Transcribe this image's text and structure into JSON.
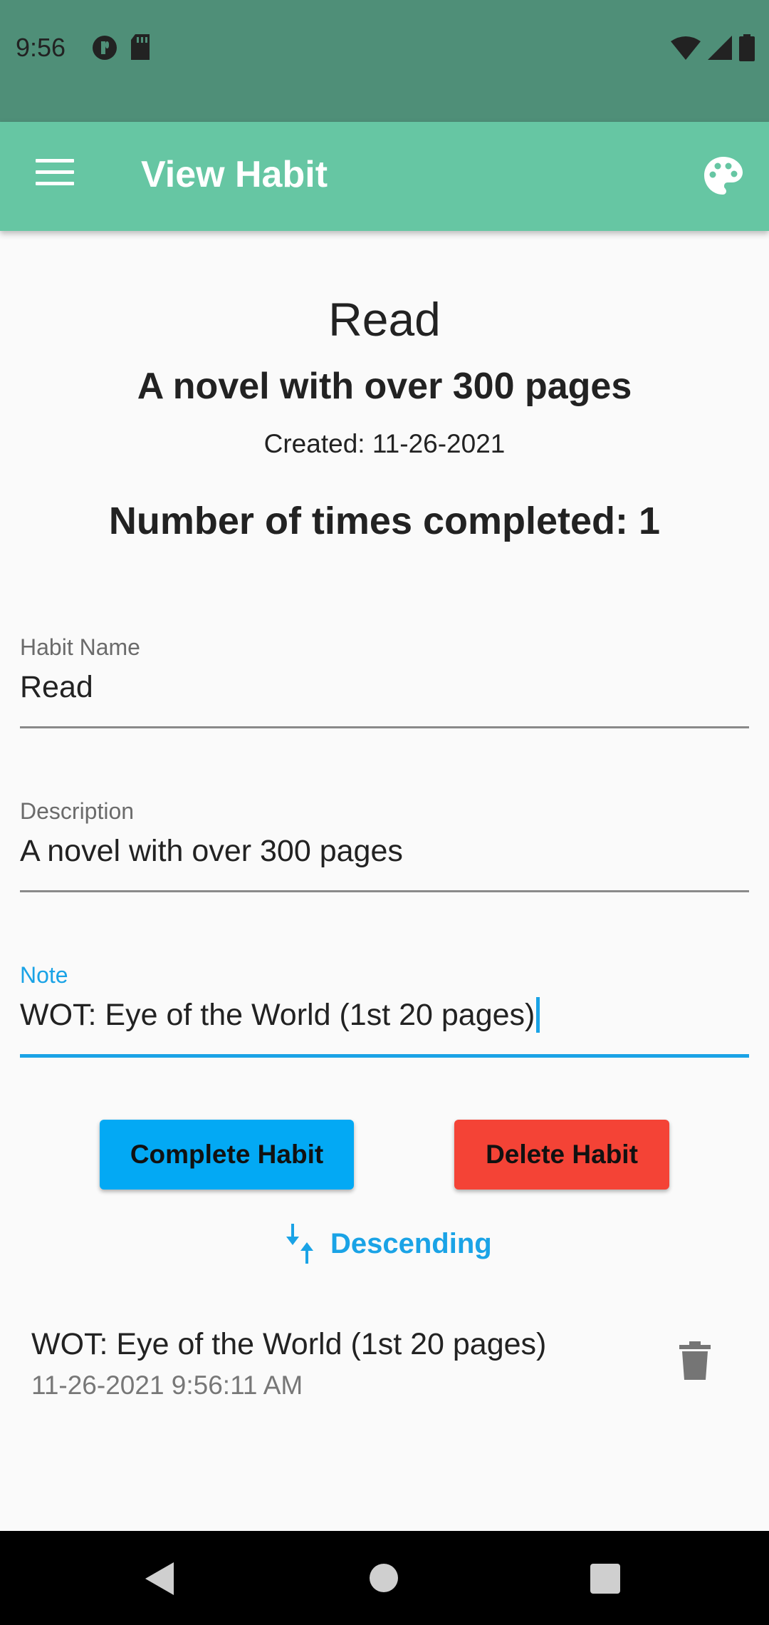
{
  "status_bar": {
    "time": "9:56",
    "left_icons": [
      "app-notification-icon",
      "sd-card-icon"
    ],
    "right_icons": [
      "wifi-icon",
      "cell-signal-icon",
      "battery-icon"
    ]
  },
  "app_bar": {
    "title": "View Habit",
    "menu_icon": "hamburger-menu-icon",
    "action_icon": "palette-icon",
    "color": "#66c6a3"
  },
  "habit": {
    "title": "Read",
    "description": "A novel with over 300 pages",
    "created": "Created: 11-26-2021",
    "completed_count": "Number of times completed: 1"
  },
  "form": {
    "name_label": "Habit Name",
    "name_value": "Read",
    "description_label": "Description",
    "description_value": "A novel with over 300 pages",
    "note_label": "Note",
    "note_value": "WOT: Eye of the World (1st 20 pages)"
  },
  "buttons": {
    "complete_label": "Complete Habit",
    "complete_color": "#03a9f4",
    "delete_label": "Delete Habit",
    "delete_color": "#f44336"
  },
  "sort": {
    "label": "Descending",
    "icon": "sort-arrows-icon",
    "color": "#1aa3e6"
  },
  "notes": [
    {
      "text": "WOT: Eye of the World (1st 20 pages)",
      "timestamp": "11-26-2021 9:56:11 AM",
      "icon": "trash-icon"
    }
  ],
  "nav_bar": {
    "items": [
      "back-icon",
      "home-icon",
      "recents-icon"
    ]
  }
}
